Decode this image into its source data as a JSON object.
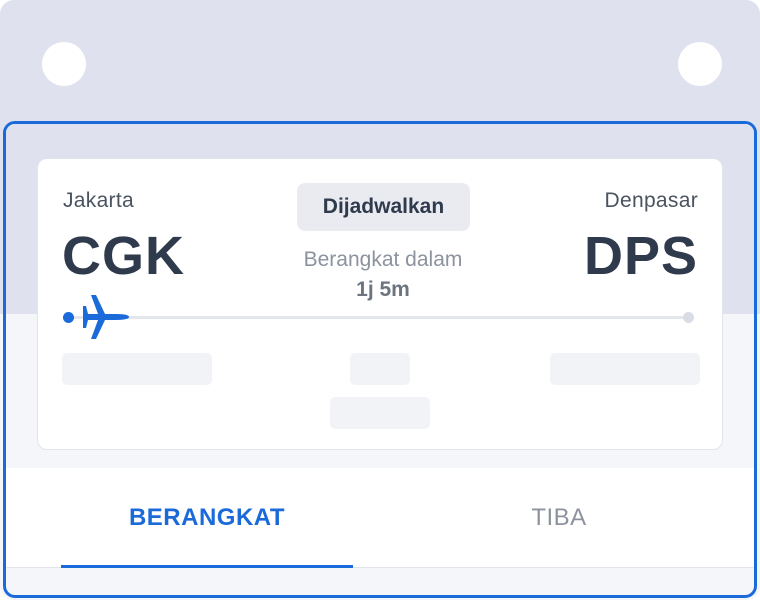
{
  "flight": {
    "origin_city": "Jakarta",
    "origin_code": "CGK",
    "destination_city": "Denpasar",
    "destination_code": "DPS",
    "status": "Dijadwalkan",
    "departure_label": "Berangkat dalam",
    "departure_value": "1j 5m"
  },
  "tabs": {
    "departure": "BERANGKAT",
    "arrival": "TIBA",
    "active": "departure"
  },
  "colors": {
    "accent": "#1b6ad9",
    "text_primary": "#2f3a4d",
    "text_muted": "#8c939e",
    "band": "#dfe2ee",
    "background": "#f5f6f9"
  },
  "icons": {
    "plane": "plane-icon"
  }
}
